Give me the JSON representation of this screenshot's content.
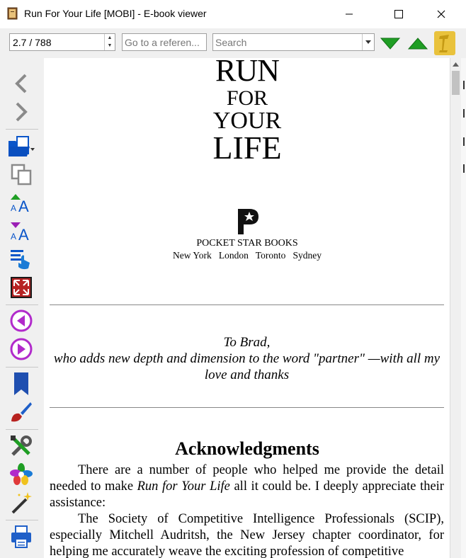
{
  "window": {
    "title": "Run For Your Life [MOBI] - E-book viewer"
  },
  "toolbar": {
    "page_position": "2.7 / 788",
    "reference_placeholder": "Go to a referen...",
    "search_placeholder": "Search"
  },
  "sidebar": {
    "icons": [
      "back-icon",
      "forward-icon",
      "open-book-icon",
      "copy-icon",
      "font-larger-icon",
      "font-smaller-icon",
      "table-of-contents-icon",
      "fullscreen-icon",
      "previous-page-icon",
      "next-page-icon",
      "bookmark-icon",
      "theme-brush-icon",
      "preferences-icon",
      "metadata-icon",
      "magic-wand-icon",
      "print-icon"
    ]
  },
  "book": {
    "cover": {
      "line1": "RUN",
      "line2": "FOR",
      "line3": "YOUR",
      "line4": "LIFE",
      "publisher": "POCKET STAR BOOKS",
      "cities": "New York   London   Toronto   Sydney"
    },
    "dedication": {
      "line1": "To Brad,",
      "line2": "who adds new depth and dimension to the word \"partner\" —with all my love and thanks"
    },
    "acknowledgments": {
      "heading": "Acknowledgments",
      "p1_start": "There are a number of people who helped me provide the detail needed to make ",
      "p1_em": "Run for Your Life",
      "p1_end": " all it could be. I deeply appreciate their assistance:",
      "p2": "The Society of Competitive Intelligence Professionals (SCIP), especially Mitchell Audritsh, the New Jersey chapter coordinator, for helping me accurately weave the exciting profession of competitive"
    }
  },
  "colors": {
    "toolbar_bg": "#f0f0f0",
    "nav_green": "#22a326",
    "accent_purple": "#9b1fb5",
    "accent_blue": "#1060c8"
  }
}
